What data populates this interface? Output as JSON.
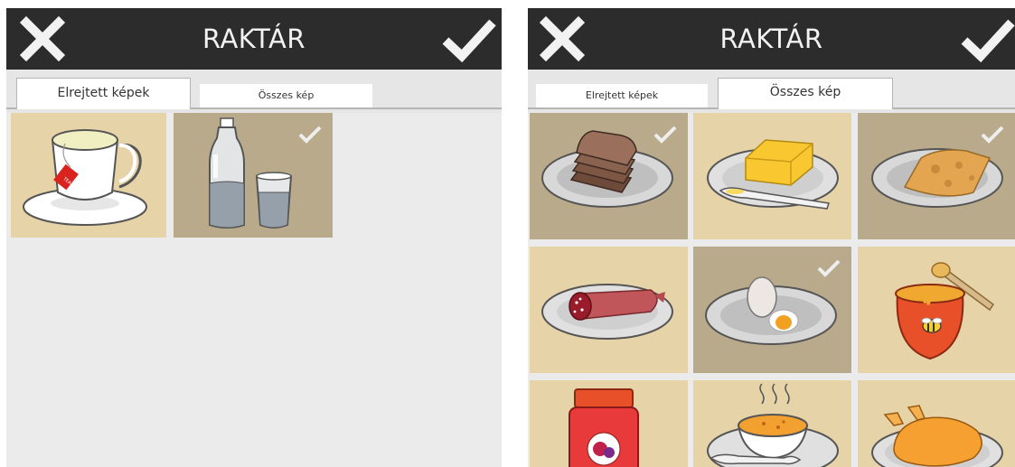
{
  "colors": {
    "header_bg": "#2c2c2c",
    "header_text": "#f2f2f2",
    "tile_light": "#e7d3a8",
    "tile_dark": "#b8aa8a",
    "content_bg": "#ebebeb"
  },
  "left_screen": {
    "title": "RAKTÁR",
    "close_icon": "close-icon",
    "confirm_icon": "check-icon",
    "tabs": [
      {
        "label": "Elrejtett képek",
        "active": true
      },
      {
        "label": "Összes kép",
        "active": false
      }
    ],
    "tiles": [
      {
        "item": "tea-icon",
        "selected": false
      },
      {
        "item": "water-bottle-icon",
        "selected": true
      }
    ]
  },
  "right_screen": {
    "title": "RAKTÁR",
    "close_icon": "close-icon",
    "confirm_icon": "check-icon",
    "tabs": [
      {
        "label": "Elrejtett képek",
        "active": false
      },
      {
        "label": "Összes kép",
        "active": true
      }
    ],
    "tiles": [
      {
        "item": "bread-icon",
        "selected": true
      },
      {
        "item": "butter-icon",
        "selected": false
      },
      {
        "item": "cheese-icon",
        "selected": true
      },
      {
        "item": "salami-icon",
        "selected": false
      },
      {
        "item": "egg-icon",
        "selected": true
      },
      {
        "item": "honey-icon",
        "selected": false
      },
      {
        "item": "jam-icon",
        "selected": false
      },
      {
        "item": "soup-icon",
        "selected": false
      },
      {
        "item": "chicken-icon",
        "selected": false
      }
    ]
  }
}
